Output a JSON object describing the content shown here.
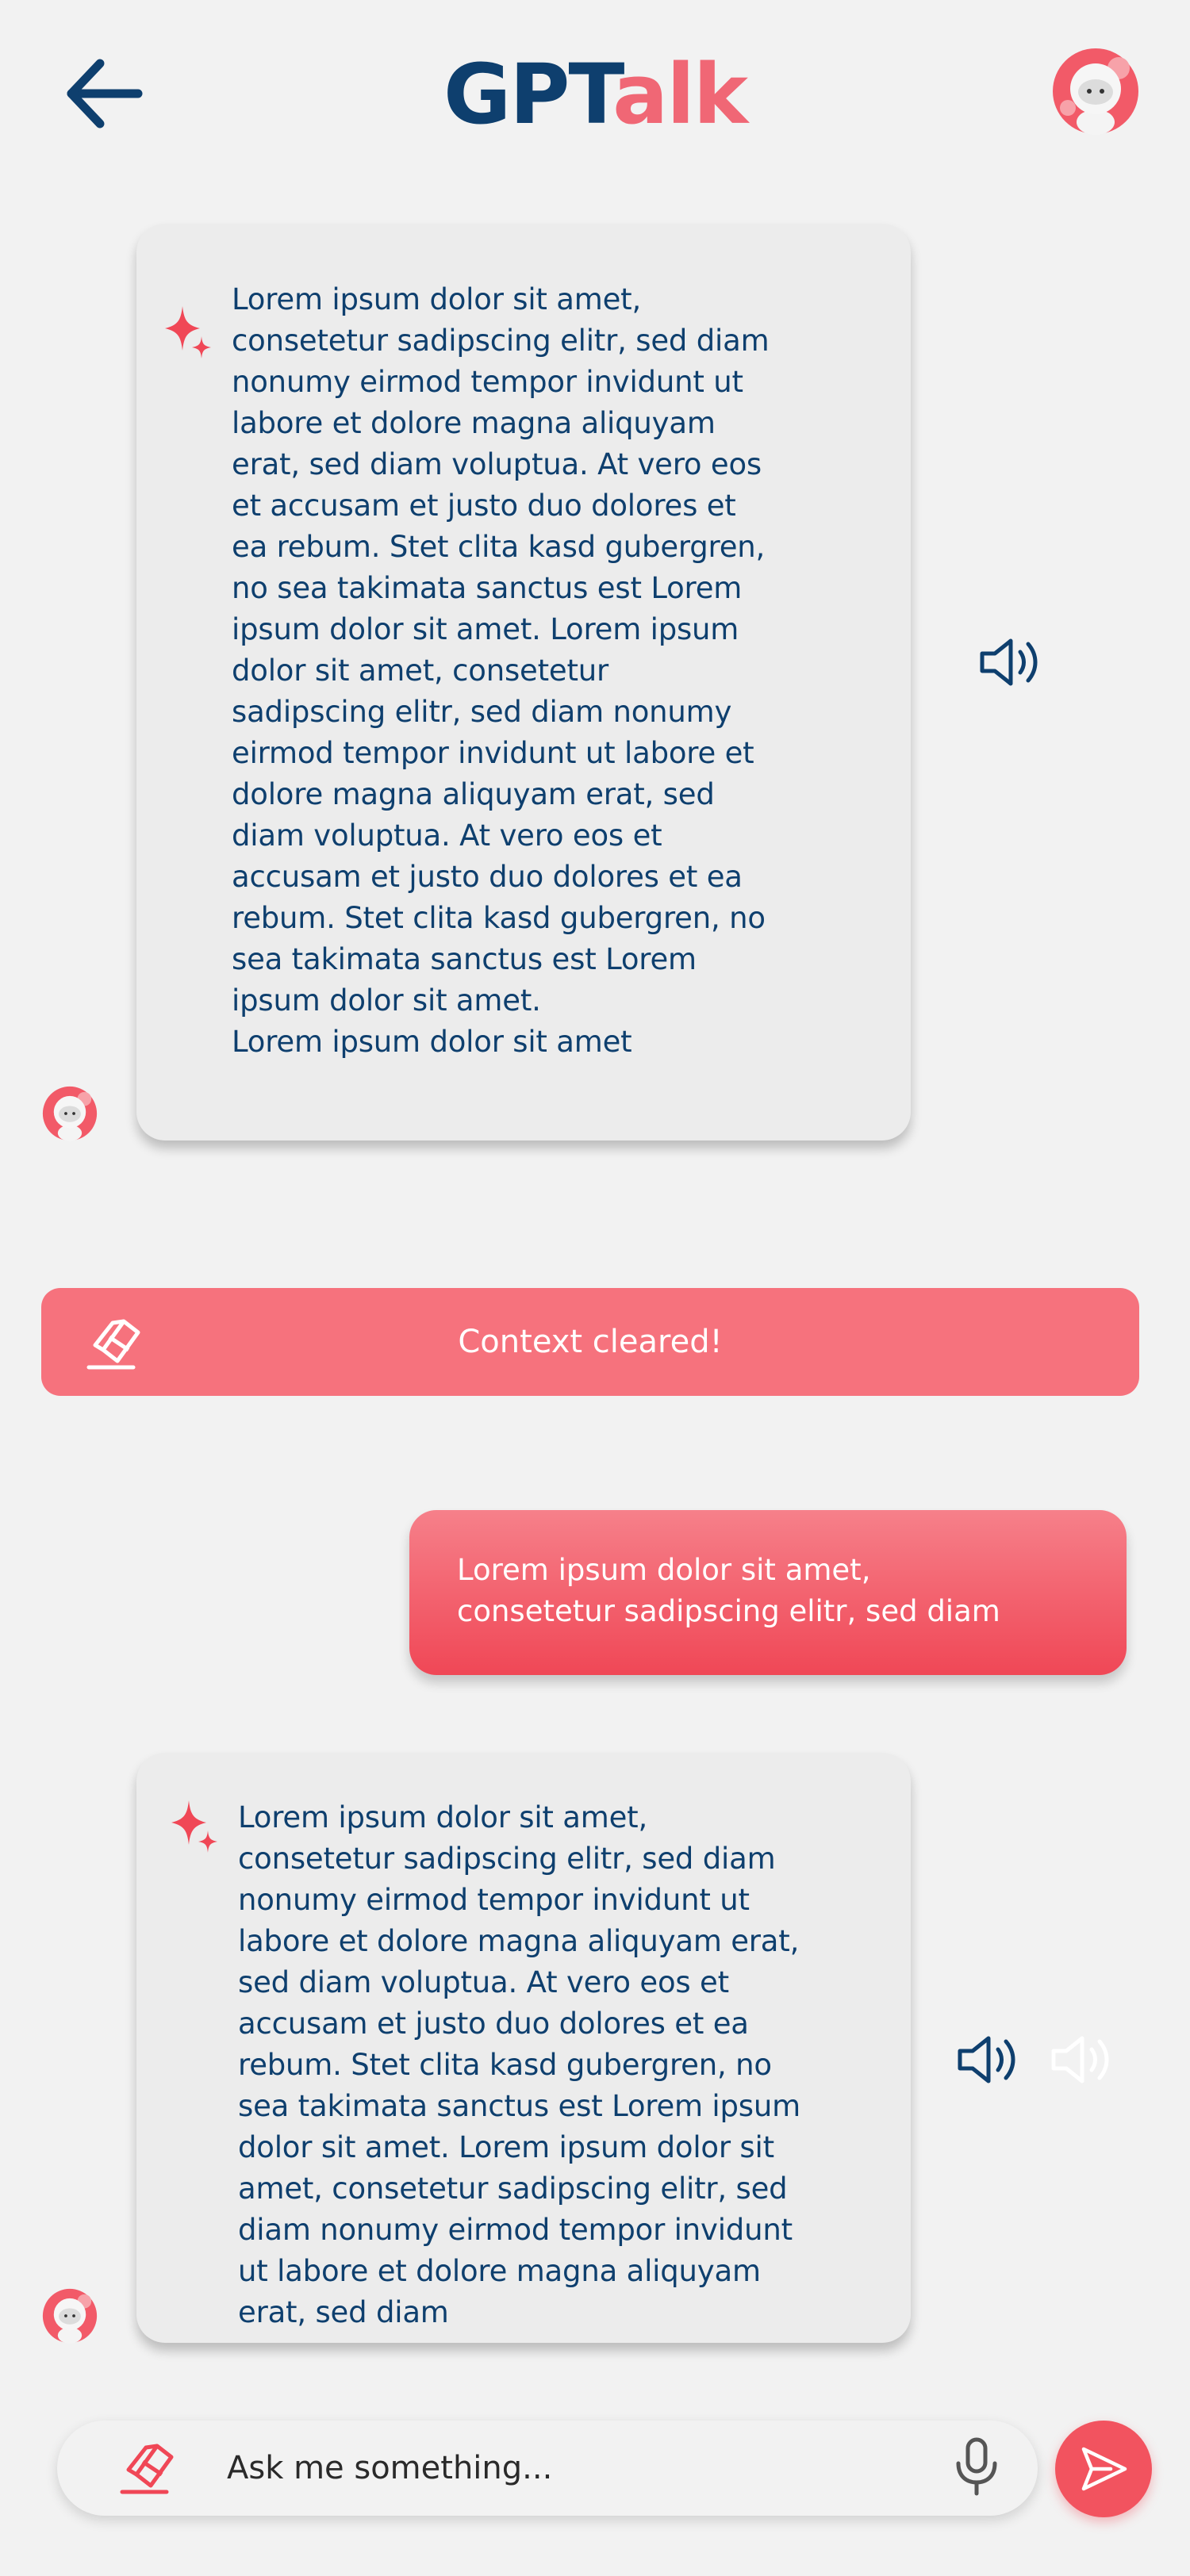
{
  "header": {
    "logo_part1": "GPT",
    "logo_part2": "alk",
    "back_icon": "arrow-left-icon",
    "avatar_icon": "robot-avatar-icon"
  },
  "messages": [
    {
      "role": "bot",
      "text": "Lorem ipsum dolor sit amet,\nconsetetur sadipscing elitr, sed diam\nnonumy eirmod tempor invidunt ut\nlabore et dolore magna aliquyam\nerat, sed diam voluptua. At vero eos\net accusam et justo duo dolores et\nea rebum. Stet clita kasd gubergren,\nno sea takimata sanctus est Lorem\nipsum dolor sit amet. Lorem ipsum\ndolor sit amet, consetetur\nsadipscing elitr, sed diam nonumy\neirmod tempor invidunt ut labore et\ndolore magna aliquyam erat, sed\ndiam voluptua. At vero eos et\naccusam et justo duo dolores et ea\nrebum. Stet clita kasd gubergren, no\nsea takimata sanctus est Lorem\nipsum dolor sit amet.\nLorem ipsum dolor sit amet"
    },
    {
      "role": "system",
      "text": "Context cleared!"
    },
    {
      "role": "user",
      "text": "Lorem ipsum dolor sit amet,\nconsetetur sadipscing elitr, sed diam"
    },
    {
      "role": "bot",
      "text": "Lorem ipsum dolor sit amet,\nconsetetur sadipscing elitr, sed diam\nnonumy eirmod tempor invidunt ut\nlabore et dolore magna aliquyam erat,\nsed diam voluptua. At vero eos et\naccusam et justo duo dolores et ea\nrebum. Stet clita kasd gubergren, no\nsea takimata sanctus est Lorem ipsum\ndolor sit amet. Lorem ipsum dolor sit\namet, consetetur sadipscing elitr, sed\ndiam nonumy eirmod tempor invidunt\nut labore et dolore magna aliquyam\nerat, sed diam"
    }
  ],
  "input": {
    "placeholder": "Ask me something...",
    "value": ""
  },
  "colors": {
    "navy": "#0e3f6e",
    "coral": "#f06775",
    "banner": "#f6727d",
    "background": "#f2f2f2"
  }
}
